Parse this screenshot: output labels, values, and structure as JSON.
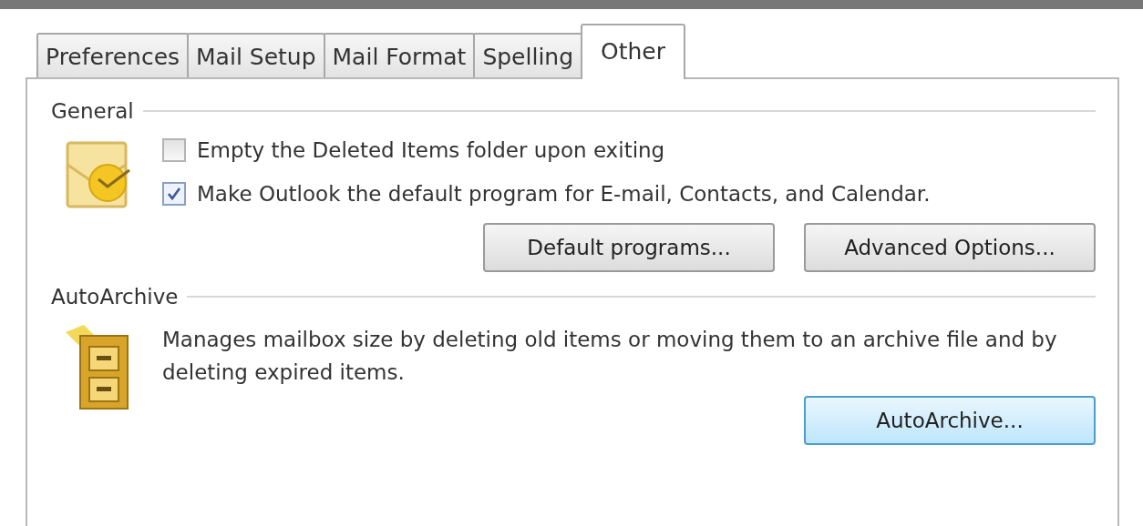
{
  "tabs": [
    {
      "label": "Preferences",
      "selected": false
    },
    {
      "label": "Mail Setup",
      "selected": false
    },
    {
      "label": "Mail Format",
      "selected": false
    },
    {
      "label": "Spelling",
      "selected": false
    },
    {
      "label": "Other",
      "selected": true
    }
  ],
  "sections": [
    {
      "title": "General",
      "kind": "mail",
      "checkboxes": [
        {
          "label": "Empty the Deleted Items folder upon exiting",
          "checked": false
        },
        {
          "label": "Make Outlook the default program for E-mail, Contacts, and Calendar.",
          "checked": true
        }
      ],
      "buttons": [
        {
          "label": "Default programs...",
          "focused": false
        },
        {
          "label": "Advanced Options...",
          "focused": false
        }
      ]
    },
    {
      "title": "AutoArchive",
      "kind": "archive",
      "description": "Manages mailbox size by deleting old items or moving them to an archive file and by deleting expired items.",
      "buttons": [
        {
          "label": "AutoArchive...",
          "focused": true
        }
      ]
    }
  ]
}
